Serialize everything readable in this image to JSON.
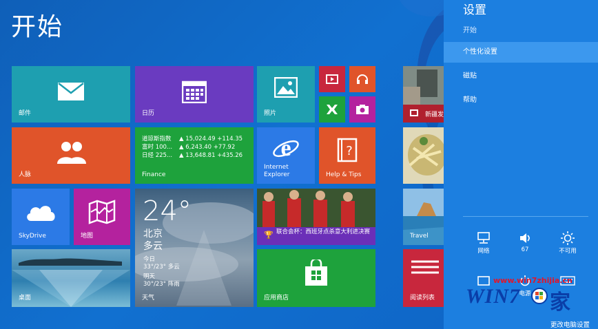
{
  "start": {
    "title": "开始"
  },
  "tiles": {
    "mail": "邮件",
    "calendar": "日历",
    "photos": "照片",
    "people": "人脉",
    "finance": {
      "label": "Finance",
      "rows": [
        {
          "name": "道琼斯指数",
          "value": "▲ 15,024.49 +114.35"
        },
        {
          "name": "富时 100...",
          "value": "▲ 6,243.40 +77.92"
        },
        {
          "name": "日经 225...",
          "value": "▲ 13,648.81 +435.26"
        }
      ]
    },
    "ie": "Internet Explorer",
    "help": "Help & Tips",
    "skydrive": "SkyDrive",
    "maps": "地图",
    "weather": {
      "temp": "24°",
      "city": "北京",
      "cond": "多云",
      "today_label": "今日",
      "today": "33°/23° 多云",
      "tomorrow_label": "明天",
      "tomorrow": "30°/23° 阵雨",
      "label": "天气"
    },
    "sports_news": "联合会杯：西班牙点杀意大利进决赛",
    "desktop": "桌面",
    "store": "应用商店",
    "news_new": "新疆发",
    "travel": "Travel",
    "reading": "阅读列表"
  },
  "charms": {
    "title": "设置",
    "subtitle": "开始",
    "items": [
      "个性化设置",
      "磁贴",
      "帮助"
    ],
    "quick": [
      {
        "label": "网络",
        "icon": "network-icon"
      },
      {
        "label": "67",
        "icon": "volume-icon"
      },
      {
        "label": "不可用",
        "icon": "brightness-icon"
      }
    ],
    "quick2": [
      "电源"
    ],
    "change_pc": "更改电脑设置"
  },
  "watermark": {
    "url": "www.win7zhijia.cn",
    "logo": "WIN7",
    "jia": "家"
  },
  "colors": {
    "teal": "#1e9fb0",
    "purple": "#6a3bc0",
    "orange": "#e0542a",
    "green": "#1ea23c",
    "blue": "#2c7ae6",
    "magenta": "#b4229e",
    "red": "#c8273d",
    "charms": "#1c7fe0"
  }
}
